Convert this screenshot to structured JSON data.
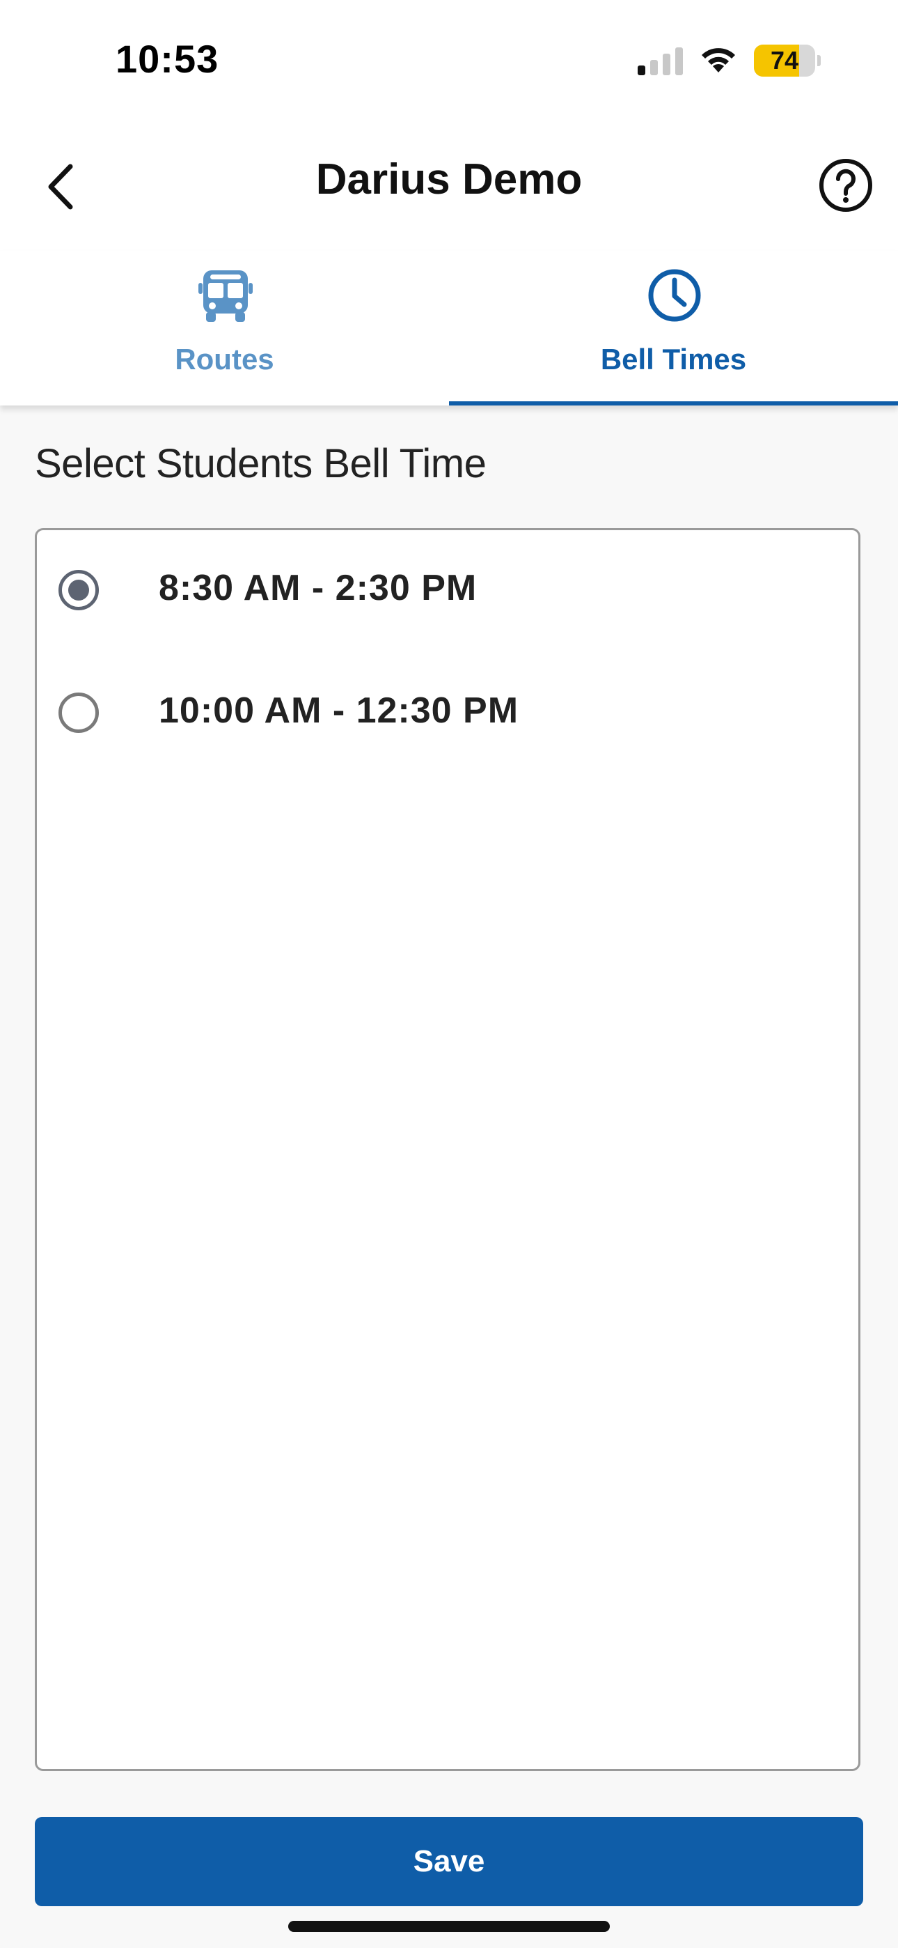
{
  "status_bar": {
    "time": "10:53",
    "battery_level": 74,
    "battery_text": "74",
    "battery_color": "#f5c400",
    "signal_bars_active": 1,
    "signal_bars_total": 4
  },
  "header": {
    "title": "Darius Demo",
    "back_icon": "chevron-left-icon",
    "help_icon": "question-circle-icon"
  },
  "tabs": [
    {
      "label": "Routes",
      "icon": "bus-icon",
      "active": false
    },
    {
      "label": "Bell Times",
      "icon": "clock-icon",
      "active": true
    }
  ],
  "bell_times": {
    "title": "Select Students Bell Time",
    "options": [
      {
        "label": "8:30 AM - 2:30 PM",
        "selected": true
      },
      {
        "label": "10:00 AM - 12:30 PM",
        "selected": false
      }
    ]
  },
  "save": {
    "label": "Save"
  },
  "colors": {
    "accent": "#0f5da8",
    "inactive_tab": "#5a93c6",
    "radio": "#5d6472"
  }
}
